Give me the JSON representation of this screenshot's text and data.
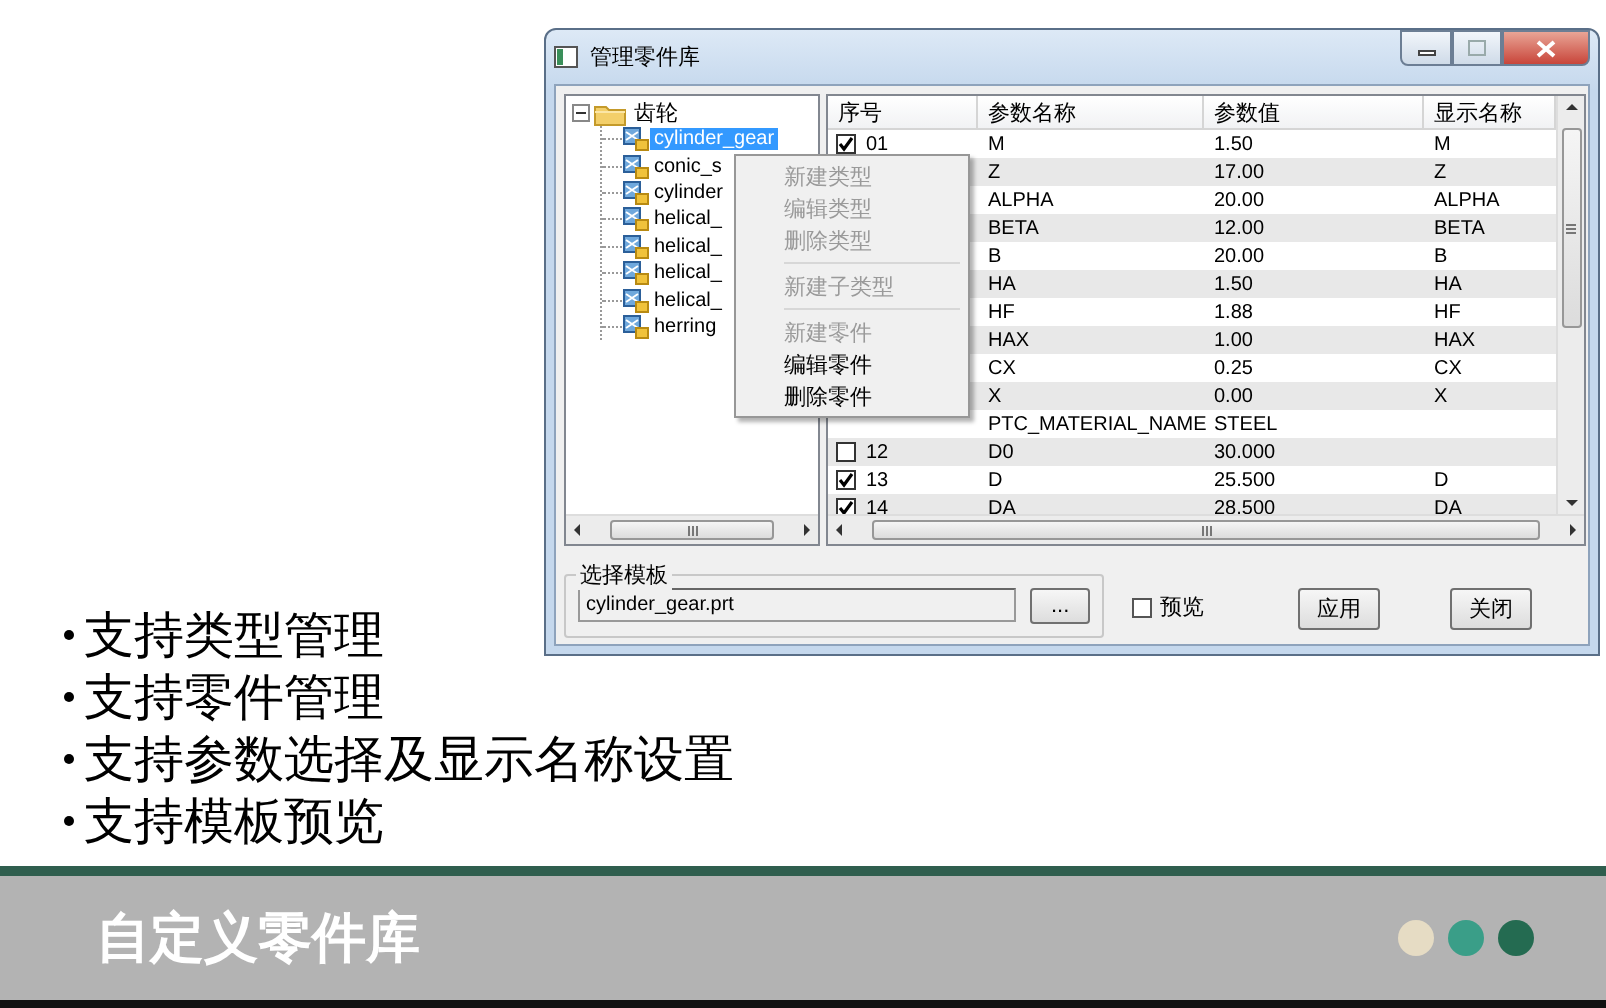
{
  "dialog": {
    "title": "管理零件库",
    "tree": {
      "label": "齿轮",
      "expanded": true,
      "children": [
        {
          "label": "cylinder_gear",
          "selected": true
        },
        {
          "label": "conic_s",
          "selected": false
        },
        {
          "label": "cylinder",
          "selected": false
        },
        {
          "label": "helical_",
          "selected": false
        },
        {
          "label": "helical_",
          "selected": false
        },
        {
          "label": "helical_",
          "selected": false
        },
        {
          "label": "helical_",
          "selected": false
        },
        {
          "label": "herring",
          "selected": false
        }
      ]
    },
    "table": {
      "columns": [
        "序号",
        "参数名称",
        "参数值",
        "显示名称"
      ],
      "rows": [
        {
          "seq": "01",
          "checked": true,
          "name": "M",
          "value": "1.50",
          "display": "M"
        },
        {
          "name": "Z",
          "value": "17.00",
          "display": "Z"
        },
        {
          "name": "ALPHA",
          "value": "20.00",
          "display": "ALPHA"
        },
        {
          "name": "BETA",
          "value": "12.00",
          "display": "BETA"
        },
        {
          "name": "B",
          "value": "20.00",
          "display": "B"
        },
        {
          "name": "HA",
          "value": "1.50",
          "display": "HA"
        },
        {
          "name": "HF",
          "value": "1.88",
          "display": "HF"
        },
        {
          "name": "HAX",
          "value": "1.00",
          "display": "HAX"
        },
        {
          "name": "CX",
          "value": "0.25",
          "display": "CX"
        },
        {
          "name": "X",
          "value": "0.00",
          "display": "X"
        },
        {
          "name": "PTC_MATERIAL_NAME",
          "value": "STEEL"
        },
        {
          "seq": "12",
          "checked": false,
          "name": "D0",
          "value": "30.000"
        },
        {
          "seq": "13",
          "checked": true,
          "name": "D",
          "value": "25.500",
          "display": "D"
        },
        {
          "seq": "14",
          "checked": true,
          "name": "DA",
          "value": "28.500",
          "display": "DA"
        }
      ]
    },
    "context_menu": [
      {
        "kind": "item",
        "label": "新建类型",
        "disabled": true
      },
      {
        "kind": "item",
        "label": "编辑类型",
        "disabled": true
      },
      {
        "kind": "item",
        "label": "删除类型",
        "disabled": true
      },
      {
        "kind": "separator"
      },
      {
        "kind": "item",
        "label": "新建子类型",
        "disabled": true
      },
      {
        "kind": "separator"
      },
      {
        "kind": "item",
        "label": "新建零件",
        "disabled": true
      },
      {
        "kind": "item",
        "label": "编辑零件",
        "disabled": false
      },
      {
        "kind": "item",
        "label": "删除零件",
        "disabled": false
      }
    ],
    "template": {
      "label": "选择模板",
      "value": "cylinder_gear.prt",
      "browse": "..."
    },
    "preview": {
      "label": "预览",
      "checked": false
    },
    "buttons": [
      "应用",
      "关闭"
    ]
  },
  "bullets": [
    "支持类型管理",
    "支持零件管理",
    "支持参数选择及显示名称设置",
    "支持模板预览"
  ],
  "footer": {
    "title": "自定义零件库",
    "dots": [
      {
        "color": "#e6dcc4"
      },
      {
        "color": "#3a9e88"
      },
      {
        "color": "#246b51"
      }
    ]
  }
}
